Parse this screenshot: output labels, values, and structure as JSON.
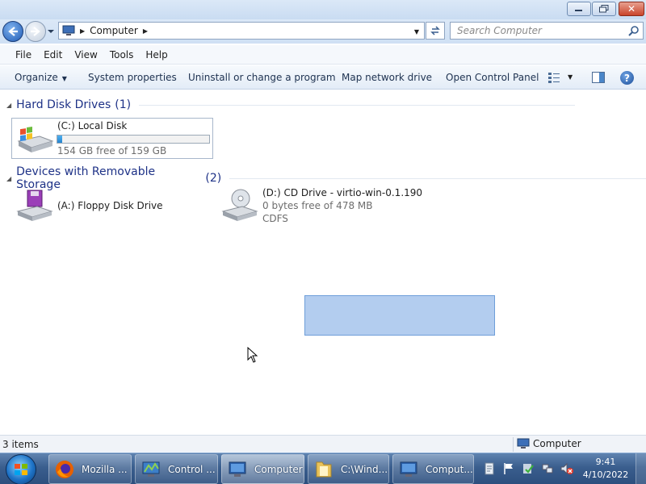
{
  "window": {
    "caption_buttons": [
      "minimize-icon",
      "maximize-icon",
      "close-icon"
    ]
  },
  "address": {
    "crumb": "Computer",
    "search_placeholder": "Search Computer"
  },
  "menu": {
    "file": "File",
    "edit": "Edit",
    "view": "View",
    "tools": "Tools",
    "help": "Help"
  },
  "commands": {
    "organize": "Organize",
    "system_properties": "System properties",
    "uninstall": "Uninstall or change a program",
    "map_drive": "Map network drive",
    "control_panel": "Open Control Panel"
  },
  "groups": {
    "hard_disks": {
      "title": "Hard Disk Drives",
      "count": "(1)"
    },
    "removable": {
      "title": "Devices with Removable Storage",
      "count": "(2)"
    }
  },
  "drives": {
    "local": {
      "name": "(C:) Local Disk",
      "free": "154 GB free of 159 GB",
      "used_fraction": 0.03
    },
    "floppy": {
      "name": "(A:) Floppy Disk Drive"
    },
    "cd": {
      "name": "(D:) CD Drive - virtio-win-0.1.190",
      "free": "0 bytes free of 478 MB",
      "fs": "CDFS"
    }
  },
  "status": {
    "count": "3 items",
    "location": "Computer"
  },
  "taskbar": {
    "buttons": [
      {
        "label": "Mozilla ..."
      },
      {
        "label": "Control ..."
      },
      {
        "label": "Computer"
      },
      {
        "label": "C:\\Wind..."
      },
      {
        "label": "Comput..."
      }
    ],
    "time": "9:41",
    "date": "4/10/2022"
  },
  "colors": {
    "accent": "#1e3287",
    "selection": "#81ace4",
    "capacity_fill": "#2584cf"
  }
}
